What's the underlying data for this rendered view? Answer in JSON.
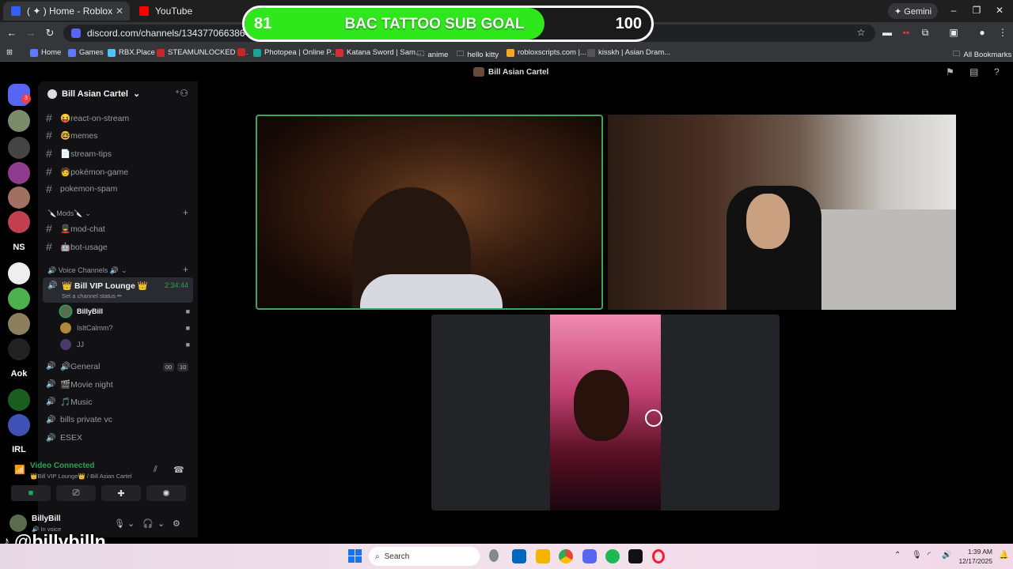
{
  "browser": {
    "tabs": [
      {
        "label": "( ✦ ) Home - Roblox",
        "icon": "roblox-icon",
        "active": true
      },
      {
        "label": "YouTube",
        "icon": "youtube-icon",
        "active": false
      }
    ],
    "gemini_label": "✦ Gemini",
    "url": "discord.com/channels/1343770663864766484/14",
    "bookmarks": [
      "Home",
      "Games",
      "RBX.Place",
      "STEAMUNLOCKED »...",
      "Photopea | Online P...",
      "Katana Sword | Sam...",
      "anime",
      "hello kitty",
      "robloxscripts.com |...",
      "kisskh | Asian Dram..."
    ],
    "all_bookmarks": "All Bookmarks"
  },
  "subgoal": {
    "current": "81",
    "target": "100",
    "label": "BAC TATTOO SUB GOAL",
    "progress_fraction": 0.81,
    "fill_color": "#2ee81c"
  },
  "discord": {
    "header_title": "Bill Asian Cartel",
    "server_name": "Bill Asian Cartel",
    "home_badge": "3",
    "text_channels": [
      {
        "name": "😝react-on-stream"
      },
      {
        "name": "🤓memes"
      },
      {
        "name": "📄stream-tips"
      },
      {
        "name": "🧑pokémon-game"
      },
      {
        "name": "pokemon-spam"
      }
    ],
    "mods_category": "🔪Mods🔪",
    "mod_channels": [
      {
        "name": "💂mod-chat"
      },
      {
        "name": "🤖bot-usage"
      }
    ],
    "voice_category": "🔊 Voice Channels 🔊",
    "active_voice": {
      "name": "👑 Bill VIP Lounge 👑",
      "status": "Set a channel status ✏",
      "duration": "2:34:44"
    },
    "voice_users": [
      "BillyBill",
      "IsItCalmm?",
      "JJ"
    ],
    "voice_channels": [
      {
        "name": "🔊General",
        "badges": [
          "00",
          "10"
        ]
      },
      {
        "name": "🎬Movie night"
      },
      {
        "name": "🎵Music"
      },
      {
        "name": "bills private vc"
      },
      {
        "name": "ESEX"
      }
    ],
    "voice_panel": {
      "title": "Video Connected",
      "subtitle": "👑Bill VIP Lounge👑 / Bill Asian Cartel"
    },
    "user": {
      "name": "BillyBill",
      "status": "🔊 In voice"
    },
    "guild_labels": [
      "NS",
      "Aok",
      "IRL"
    ]
  },
  "overlay": {
    "tiktok_handle": "@billybilln"
  },
  "taskbar": {
    "search_placeholder": "Search",
    "time": "1:39 AM",
    "date": "12/17/2025"
  }
}
